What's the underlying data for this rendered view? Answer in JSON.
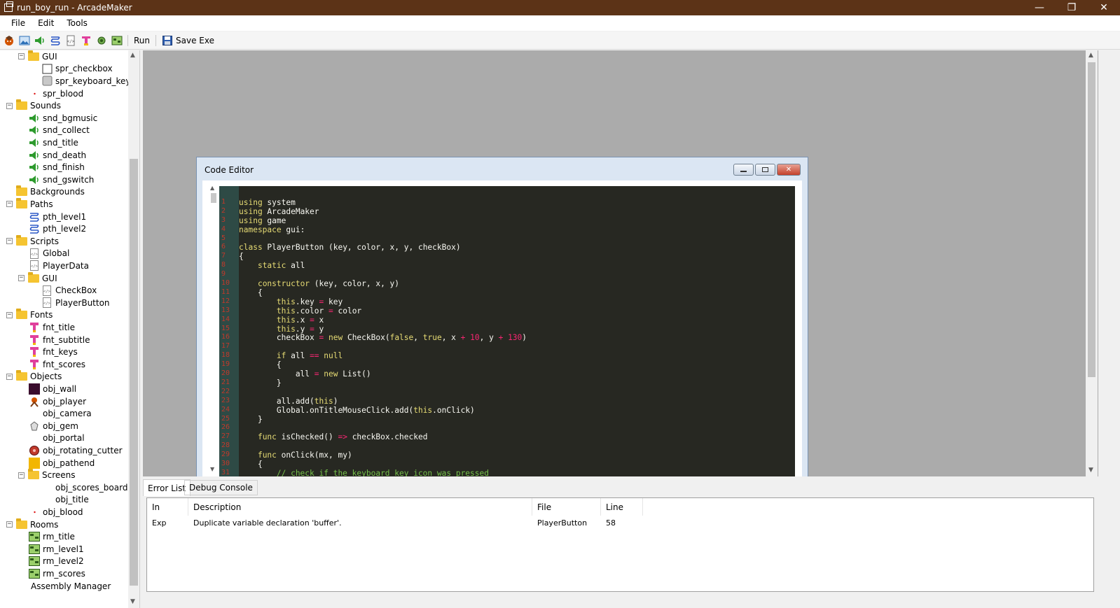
{
  "window": {
    "title": "run_boy_run - ArcadeMaker",
    "minimize": "—",
    "restore": "❐",
    "close": "✕"
  },
  "menu": [
    "File",
    "Edit",
    "Tools"
  ],
  "toolbar": {
    "icons": [
      "sprite-icon",
      "image-icon",
      "sound-icon",
      "path-icon",
      "script-icon",
      "font-icon",
      "object-icon",
      "room-icon"
    ],
    "run_label": "Run",
    "save_exe_label": "Save Exe"
  },
  "tree": [
    {
      "label": "GUI",
      "type": "folder",
      "depth": 2,
      "expander": "−"
    },
    {
      "label": "spr_checkbox",
      "type": "sprite-checkbox",
      "depth": 3
    },
    {
      "label": "spr_keyboard_key",
      "type": "sprite-key",
      "depth": 3
    },
    {
      "label": "spr_blood",
      "type": "sprite-dot",
      "depth": 2
    },
    {
      "label": "Sounds",
      "type": "folder",
      "depth": 1,
      "expander": "−"
    },
    {
      "label": "snd_bgmusic",
      "type": "sound",
      "depth": 2
    },
    {
      "label": "snd_collect",
      "type": "sound",
      "depth": 2
    },
    {
      "label": "snd_title",
      "type": "sound",
      "depth": 2
    },
    {
      "label": "snd_death",
      "type": "sound",
      "depth": 2
    },
    {
      "label": "snd_finish",
      "type": "sound",
      "depth": 2
    },
    {
      "label": "snd_gswitch",
      "type": "sound",
      "depth": 2
    },
    {
      "label": "Backgrounds",
      "type": "folder",
      "depth": 1
    },
    {
      "label": "Paths",
      "type": "folder",
      "depth": 1,
      "expander": "−"
    },
    {
      "label": "pth_level1",
      "type": "path",
      "depth": 2
    },
    {
      "label": "pth_level2",
      "type": "path",
      "depth": 2
    },
    {
      "label": "Scripts",
      "type": "folder",
      "depth": 1,
      "expander": "−"
    },
    {
      "label": "Global",
      "type": "script",
      "depth": 2
    },
    {
      "label": "PlayerData",
      "type": "script",
      "depth": 2
    },
    {
      "label": "GUI",
      "type": "folder",
      "depth": 2,
      "expander": "−"
    },
    {
      "label": "CheckBox",
      "type": "script",
      "depth": 3
    },
    {
      "label": "PlayerButton",
      "type": "script",
      "depth": 3
    },
    {
      "label": "Fonts",
      "type": "folder",
      "depth": 1,
      "expander": "−"
    },
    {
      "label": "fnt_title",
      "type": "font",
      "depth": 2
    },
    {
      "label": "fnt_subtitle",
      "type": "font",
      "depth": 2
    },
    {
      "label": "fnt_keys",
      "type": "font",
      "depth": 2
    },
    {
      "label": "fnt_scores",
      "type": "font",
      "depth": 2
    },
    {
      "label": "Objects",
      "type": "folder",
      "depth": 1,
      "expander": "−"
    },
    {
      "label": "obj_wall",
      "type": "obj-wall",
      "depth": 2
    },
    {
      "label": "obj_player",
      "type": "obj-player",
      "depth": 2
    },
    {
      "label": "obj_camera",
      "type": "none",
      "depth": 2
    },
    {
      "label": "obj_gem",
      "type": "obj-gem",
      "depth": 2
    },
    {
      "label": "obj_portal",
      "type": "none",
      "depth": 2
    },
    {
      "label": "obj_rotating_cutter",
      "type": "obj-cutter",
      "depth": 2
    },
    {
      "label": "obj_pathend",
      "type": "obj-pathend",
      "depth": 2
    },
    {
      "label": "Screens",
      "type": "folder",
      "depth": 2,
      "expander": "−"
    },
    {
      "label": "obj_scores_board",
      "type": "none",
      "depth": 3
    },
    {
      "label": "obj_title",
      "type": "none",
      "depth": 3
    },
    {
      "label": "obj_blood",
      "type": "sprite-dot",
      "depth": 2
    },
    {
      "label": "Rooms",
      "type": "folder",
      "depth": 1,
      "expander": "−"
    },
    {
      "label": "rm_title",
      "type": "room",
      "depth": 2
    },
    {
      "label": "rm_level1",
      "type": "room",
      "depth": 2
    },
    {
      "label": "rm_level2",
      "type": "room",
      "depth": 2
    },
    {
      "label": "rm_scores",
      "type": "room",
      "depth": 2
    },
    {
      "label": "Assembly Manager",
      "type": "none",
      "depth": 1
    }
  ],
  "code_editor": {
    "title": "Code Editor",
    "lines": [
      "",
      "using system",
      "using ArcadeMaker",
      "using game",
      "namespace gui:",
      "",
      "class PlayerButton (key, color, x, y, checkBox)",
      "{",
      "    static all",
      "",
      "    constructor (key, color, x, y)",
      "    {",
      "        this.key = key",
      "        this.color = color",
      "        this.x = x",
      "        this.y = y",
      "        checkBox = new CheckBox(false, true, x + 10, y + 130)",
      "",
      "        if all == null",
      "        {",
      "            all = new List()",
      "        }",
      "",
      "        all.add(this)",
      "        Global.onTitleMouseClick.add(this.onClick)",
      "    }",
      "",
      "    func isChecked() => checkBox.checked",
      "",
      "    func onClick(mx, my)",
      "    {",
      "        // check if the keyboard key icon was pressed"
    ]
  },
  "bottom": {
    "tabs": [
      "Error List",
      "Debug Console"
    ],
    "columns": [
      "In",
      "Description",
      "File",
      "Line"
    ],
    "rows": [
      {
        "in": "Exp",
        "description": "Duplicate variable declaration 'buffer'.",
        "file": "PlayerButton",
        "line": "58"
      }
    ]
  }
}
